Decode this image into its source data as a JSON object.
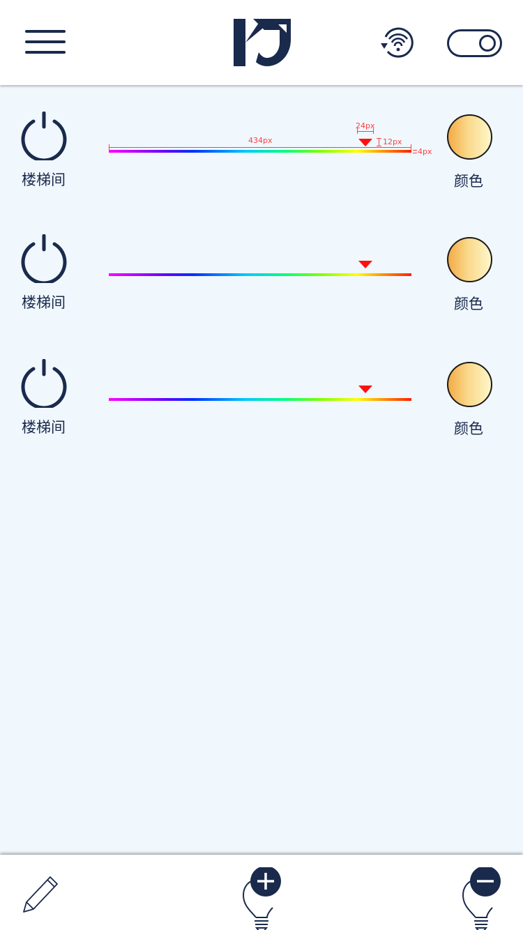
{
  "header": {
    "menu_icon": "hamburger-menu-icon",
    "logo_icon": "brand-logo",
    "wifi_icon": "wifi-refresh-icon",
    "toggle_icon": "toggle-switch-icon",
    "toggle_state": "on"
  },
  "rows": [
    {
      "label": "楼梯间",
      "color_label": "颜色",
      "slider_value_percent": 84.8
    },
    {
      "label": "楼梯间",
      "color_label": "颜色",
      "slider_value_percent": 84.8
    },
    {
      "label": "楼梯间",
      "color_label": "颜色",
      "slider_value_percent": 84.8
    }
  ],
  "annotations": {
    "width_label": "434px",
    "thumb_width_label": "24px",
    "thumb_height_label": "12px",
    "bar_height_label": "4px"
  },
  "footer": {
    "edit_icon": "pencil-icon",
    "add_icon": "bulb-add-icon",
    "remove_icon": "bulb-remove-icon"
  },
  "colors": {
    "primary": "#1a2a4c",
    "background": "#f0f7fd",
    "thumb": "#ff1010",
    "annotation": "#ff4040"
  }
}
